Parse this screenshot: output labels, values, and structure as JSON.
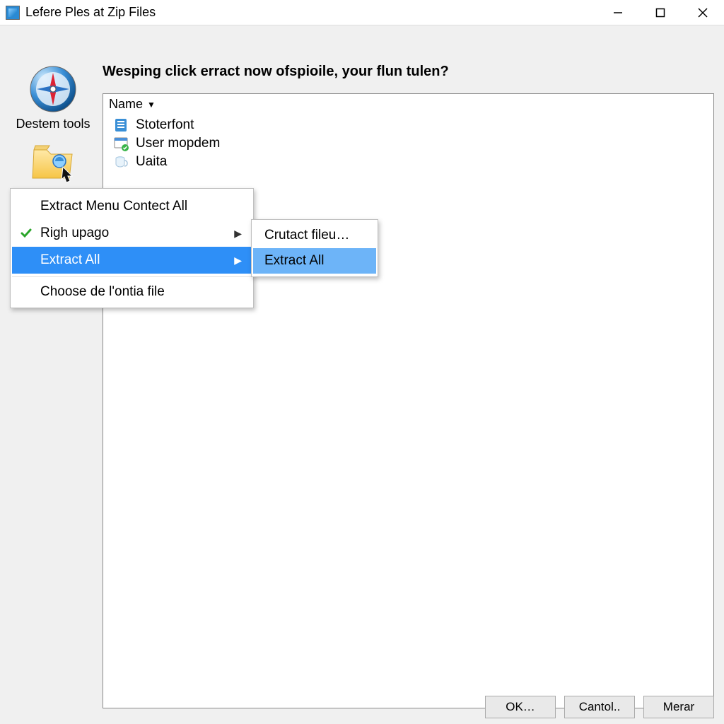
{
  "window": {
    "title": "Lefere Ples at Zip Files"
  },
  "sidebar": {
    "tool_label": "Destem tools"
  },
  "main": {
    "heading": "Wesping click erract now ofspioile, your flun tulen?",
    "column_header": "Name",
    "items": [
      {
        "label": "Stoterfont"
      },
      {
        "label": "User mopdem"
      },
      {
        "label": "Uaita"
      }
    ]
  },
  "context_menu": {
    "items": [
      {
        "label": "Extract Menu Contect All"
      },
      {
        "label": "Righ upago"
      },
      {
        "label": "Extract All"
      },
      {
        "label": "Choose de l'ontia file"
      }
    ],
    "submenu": [
      {
        "label": "Crutact fileu…"
      },
      {
        "label": "Extract All"
      }
    ]
  },
  "buttons": {
    "ok": "OK…",
    "cancel": "Cantol..",
    "more": "Merar"
  }
}
